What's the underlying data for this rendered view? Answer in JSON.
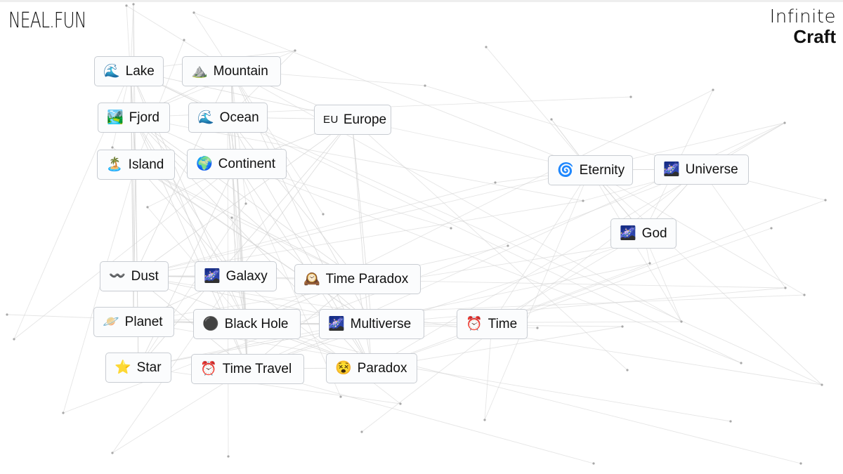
{
  "header": {
    "logo": "NEAL.FUN",
    "brand_line1": "Infinite",
    "brand_line2": "Craft"
  },
  "items": [
    {
      "id": "lake",
      "label": "Lake",
      "icon": "water-wave-icon",
      "glyph": "🌊"
    },
    {
      "id": "mountain",
      "label": "Mountain",
      "icon": "mountain-icon",
      "glyph": "⛰️"
    },
    {
      "id": "fjord",
      "label": "Fjord",
      "icon": "fjord-landscape-icon",
      "glyph": "🏞️"
    },
    {
      "id": "ocean",
      "label": "Ocean",
      "icon": "water-wave-icon",
      "glyph": "🌊"
    },
    {
      "id": "europe",
      "label": "Europe",
      "icon": "eu-flag-icon",
      "glyph": "EU"
    },
    {
      "id": "island",
      "label": "Island",
      "icon": "desert-island-icon",
      "glyph": "🏝️"
    },
    {
      "id": "continent",
      "label": "Continent",
      "icon": "globe-icon",
      "glyph": "🌍"
    },
    {
      "id": "eternity",
      "label": "Eternity",
      "icon": "cyclone-icon",
      "glyph": "🌀"
    },
    {
      "id": "universe",
      "label": "Universe",
      "icon": "galaxy-icon",
      "glyph": "🌌"
    },
    {
      "id": "god",
      "label": "God",
      "icon": "galaxy-icon",
      "glyph": "🌌"
    },
    {
      "id": "dust",
      "label": "Dust",
      "icon": "wind-waves-icon",
      "glyph": "〰️"
    },
    {
      "id": "galaxy",
      "label": "Galaxy",
      "icon": "galaxy-icon",
      "glyph": "🌌"
    },
    {
      "id": "time-paradox",
      "label": "Time Paradox",
      "icon": "mantel-clock-icon",
      "glyph": "🕰️"
    },
    {
      "id": "planet",
      "label": "Planet",
      "icon": "ringed-planet-icon",
      "glyph": "🪐"
    },
    {
      "id": "black-hole",
      "label": "Black Hole",
      "icon": "black-hole-icon",
      "glyph": "⚫"
    },
    {
      "id": "multiverse",
      "label": "Multiverse",
      "icon": "galaxy-icon",
      "glyph": "🌌"
    },
    {
      "id": "time",
      "label": "Time",
      "icon": "alarm-clock-icon",
      "glyph": "⏰"
    },
    {
      "id": "star",
      "label": "Star",
      "icon": "star-icon",
      "glyph": "⭐"
    },
    {
      "id": "time-travel",
      "label": "Time Travel",
      "icon": "alarm-clock-icon",
      "glyph": "⏰"
    },
    {
      "id": "paradox",
      "label": "Paradox",
      "icon": "dizzy-face-icon",
      "glyph": "😵"
    }
  ]
}
